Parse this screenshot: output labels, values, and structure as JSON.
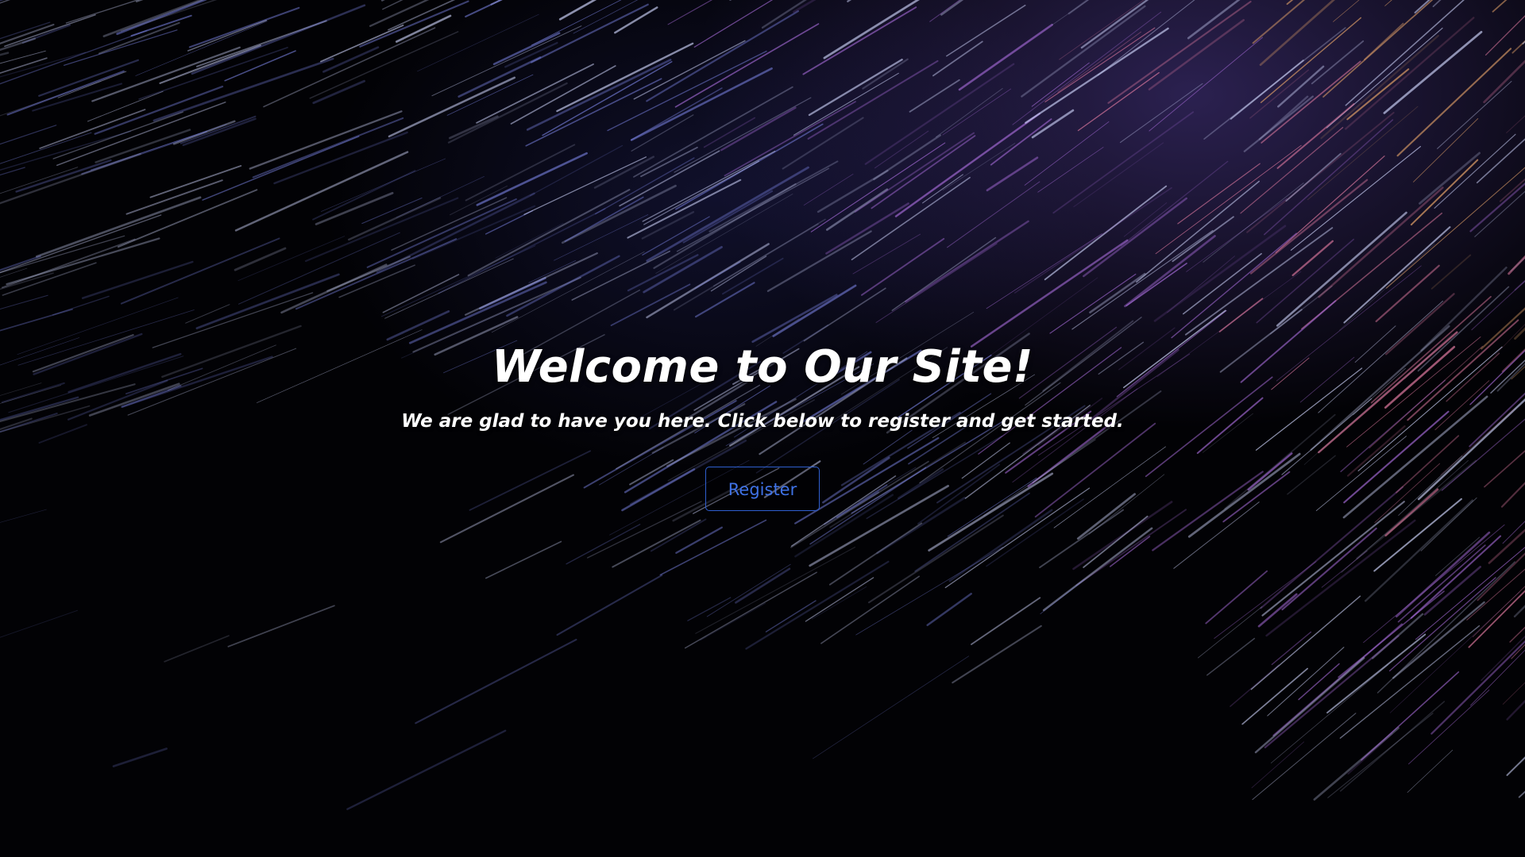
{
  "hero": {
    "title": "Welcome to Our Site!",
    "subtitle": "We are glad to have you here. Click below to register and get started.",
    "button_label": "Register"
  },
  "colors": {
    "background": "#020205",
    "text": "#ffffff",
    "button_accent": "#3f72e6",
    "streak_blue": "#7d86e8",
    "streak_purple": "#a46ad6",
    "streak_pink": "#e07aa0",
    "streak_orange": "#e8a56a"
  }
}
